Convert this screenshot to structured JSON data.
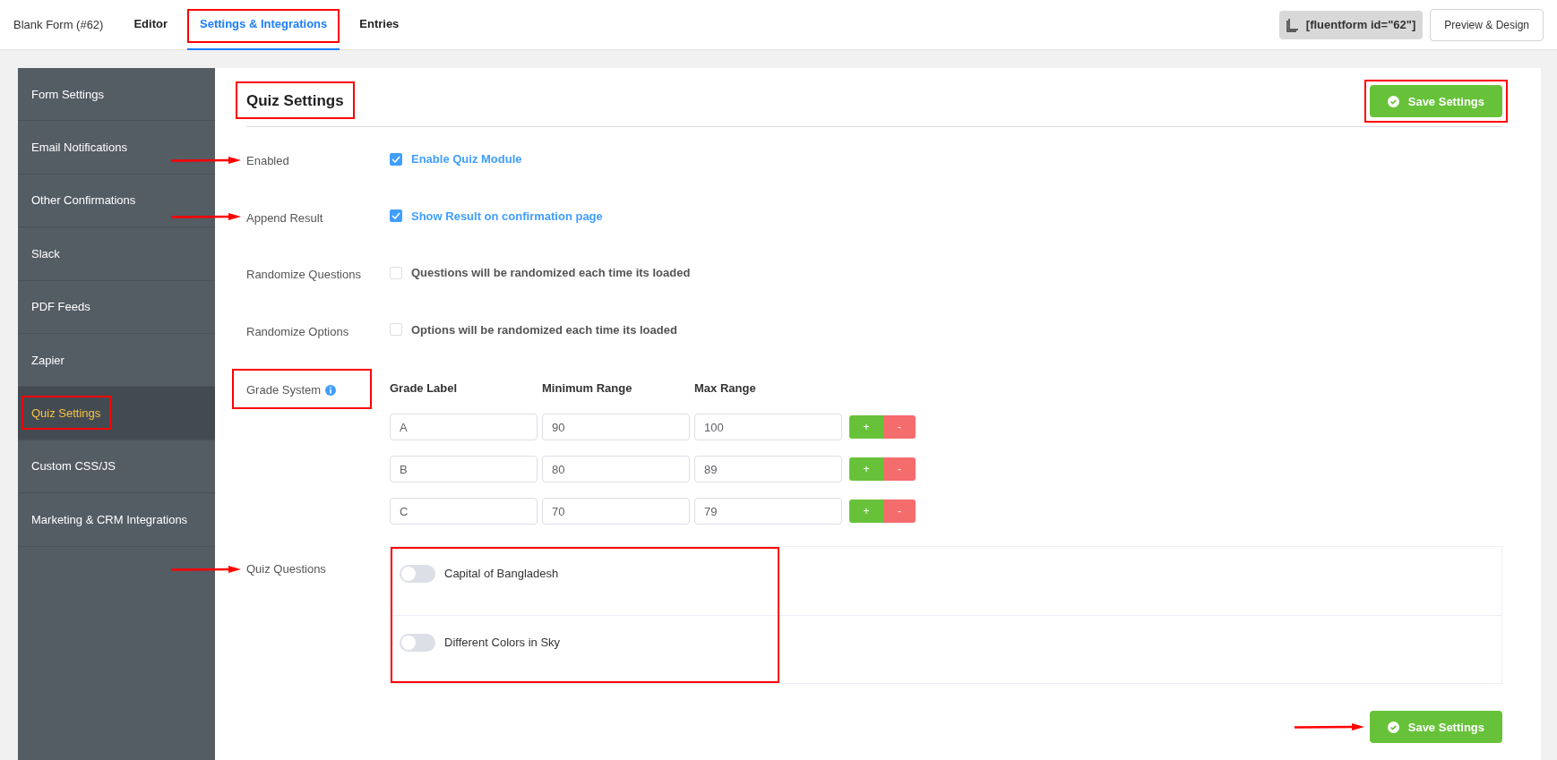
{
  "header": {
    "form_title": "Blank Form (#62)",
    "tabs": [
      {
        "label": "Editor",
        "selected": false,
        "highlighted": false
      },
      {
        "label": "Settings & Integrations",
        "selected": true,
        "highlighted": true
      },
      {
        "label": "Entries",
        "selected": false,
        "highlighted": false
      }
    ],
    "shortcode": "[fluentform id=\"62\"]",
    "preview_button": "Preview & Design"
  },
  "sidebar": {
    "items": [
      {
        "label": "Form Settings",
        "selected": false,
        "highlighted": false
      },
      {
        "label": "Email Notifications",
        "selected": false,
        "highlighted": false
      },
      {
        "label": "Other Confirmations",
        "selected": false,
        "highlighted": false
      },
      {
        "label": "Slack",
        "selected": false,
        "highlighted": false
      },
      {
        "label": "PDF Feeds",
        "selected": false,
        "highlighted": false
      },
      {
        "label": "Zapier",
        "selected": false,
        "highlighted": false
      },
      {
        "label": "Quiz Settings",
        "selected": true,
        "highlighted": true
      },
      {
        "label": "Custom CSS/JS",
        "selected": false,
        "highlighted": false
      },
      {
        "label": "Marketing & CRM Integrations",
        "selected": false,
        "highlighted": false
      }
    ]
  },
  "panel": {
    "title": "Quiz Settings",
    "title_highlighted": true,
    "save_button": {
      "label": "Save Settings",
      "highlighted": true,
      "arrow": false
    }
  },
  "settings": [
    {
      "label": "Enabled",
      "arrow": true,
      "checked": true,
      "text": "Enable Quiz Module"
    },
    {
      "label": "Append Result",
      "arrow": true,
      "checked": true,
      "text": "Show Result on confirmation page"
    },
    {
      "label": "Randomize Questions",
      "arrow": false,
      "checked": false,
      "text": "Questions will be randomized each time its loaded"
    },
    {
      "label": "Randomize Options",
      "arrow": false,
      "checked": false,
      "text": "Options will be randomized each time its loaded"
    }
  ],
  "grade_system": {
    "label": "Grade System",
    "highlighted": true,
    "columns": [
      "Grade Label",
      "Minimum Range",
      "Max Range"
    ],
    "rows": [
      {
        "label": "A",
        "min": "90",
        "max": "100",
        "add": "+",
        "remove": "-"
      },
      {
        "label": "B",
        "min": "80",
        "max": "89",
        "add": "+",
        "remove": "-"
      },
      {
        "label": "C",
        "min": "70",
        "max": "79",
        "add": "+",
        "remove": "-"
      }
    ]
  },
  "quiz_questions": {
    "label": "Quiz Questions",
    "arrow": true,
    "highlighted": true,
    "questions": [
      {
        "title": "Capital of Bangladesh",
        "on": false
      },
      {
        "title": "Different Colors in Sky",
        "on": false
      }
    ]
  },
  "footer_save": {
    "label": "Save Settings",
    "highlighted": false,
    "arrow": true
  }
}
